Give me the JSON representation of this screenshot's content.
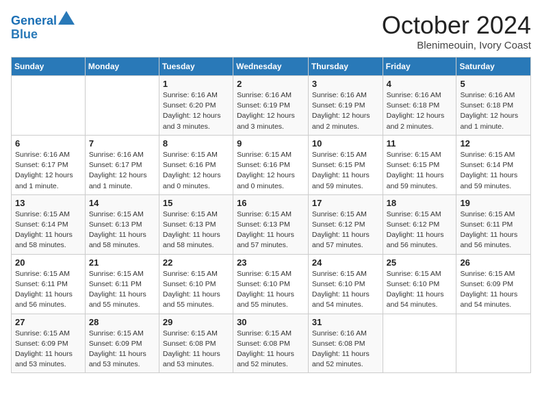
{
  "header": {
    "logo_line1": "General",
    "logo_line2": "Blue",
    "month_title": "October 2024",
    "location": "Blenimeouin, Ivory Coast"
  },
  "weekdays": [
    "Sunday",
    "Monday",
    "Tuesday",
    "Wednesday",
    "Thursday",
    "Friday",
    "Saturday"
  ],
  "weeks": [
    [
      {
        "day": "",
        "sunrise": "",
        "sunset": "",
        "daylight": ""
      },
      {
        "day": "",
        "sunrise": "",
        "sunset": "",
        "daylight": ""
      },
      {
        "day": "1",
        "sunrise": "Sunrise: 6:16 AM",
        "sunset": "Sunset: 6:20 PM",
        "daylight": "Daylight: 12 hours and 3 minutes."
      },
      {
        "day": "2",
        "sunrise": "Sunrise: 6:16 AM",
        "sunset": "Sunset: 6:19 PM",
        "daylight": "Daylight: 12 hours and 3 minutes."
      },
      {
        "day": "3",
        "sunrise": "Sunrise: 6:16 AM",
        "sunset": "Sunset: 6:19 PM",
        "daylight": "Daylight: 12 hours and 2 minutes."
      },
      {
        "day": "4",
        "sunrise": "Sunrise: 6:16 AM",
        "sunset": "Sunset: 6:18 PM",
        "daylight": "Daylight: 12 hours and 2 minutes."
      },
      {
        "day": "5",
        "sunrise": "Sunrise: 6:16 AM",
        "sunset": "Sunset: 6:18 PM",
        "daylight": "Daylight: 12 hours and 1 minute."
      }
    ],
    [
      {
        "day": "6",
        "sunrise": "Sunrise: 6:16 AM",
        "sunset": "Sunset: 6:17 PM",
        "daylight": "Daylight: 12 hours and 1 minute."
      },
      {
        "day": "7",
        "sunrise": "Sunrise: 6:16 AM",
        "sunset": "Sunset: 6:17 PM",
        "daylight": "Daylight: 12 hours and 1 minute."
      },
      {
        "day": "8",
        "sunrise": "Sunrise: 6:15 AM",
        "sunset": "Sunset: 6:16 PM",
        "daylight": "Daylight: 12 hours and 0 minutes."
      },
      {
        "day": "9",
        "sunrise": "Sunrise: 6:15 AM",
        "sunset": "Sunset: 6:16 PM",
        "daylight": "Daylight: 12 hours and 0 minutes."
      },
      {
        "day": "10",
        "sunrise": "Sunrise: 6:15 AM",
        "sunset": "Sunset: 6:15 PM",
        "daylight": "Daylight: 11 hours and 59 minutes."
      },
      {
        "day": "11",
        "sunrise": "Sunrise: 6:15 AM",
        "sunset": "Sunset: 6:15 PM",
        "daylight": "Daylight: 11 hours and 59 minutes."
      },
      {
        "day": "12",
        "sunrise": "Sunrise: 6:15 AM",
        "sunset": "Sunset: 6:14 PM",
        "daylight": "Daylight: 11 hours and 59 minutes."
      }
    ],
    [
      {
        "day": "13",
        "sunrise": "Sunrise: 6:15 AM",
        "sunset": "Sunset: 6:14 PM",
        "daylight": "Daylight: 11 hours and 58 minutes."
      },
      {
        "day": "14",
        "sunrise": "Sunrise: 6:15 AM",
        "sunset": "Sunset: 6:13 PM",
        "daylight": "Daylight: 11 hours and 58 minutes."
      },
      {
        "day": "15",
        "sunrise": "Sunrise: 6:15 AM",
        "sunset": "Sunset: 6:13 PM",
        "daylight": "Daylight: 11 hours and 58 minutes."
      },
      {
        "day": "16",
        "sunrise": "Sunrise: 6:15 AM",
        "sunset": "Sunset: 6:13 PM",
        "daylight": "Daylight: 11 hours and 57 minutes."
      },
      {
        "day": "17",
        "sunrise": "Sunrise: 6:15 AM",
        "sunset": "Sunset: 6:12 PM",
        "daylight": "Daylight: 11 hours and 57 minutes."
      },
      {
        "day": "18",
        "sunrise": "Sunrise: 6:15 AM",
        "sunset": "Sunset: 6:12 PM",
        "daylight": "Daylight: 11 hours and 56 minutes."
      },
      {
        "day": "19",
        "sunrise": "Sunrise: 6:15 AM",
        "sunset": "Sunset: 6:11 PM",
        "daylight": "Daylight: 11 hours and 56 minutes."
      }
    ],
    [
      {
        "day": "20",
        "sunrise": "Sunrise: 6:15 AM",
        "sunset": "Sunset: 6:11 PM",
        "daylight": "Daylight: 11 hours and 56 minutes."
      },
      {
        "day": "21",
        "sunrise": "Sunrise: 6:15 AM",
        "sunset": "Sunset: 6:11 PM",
        "daylight": "Daylight: 11 hours and 55 minutes."
      },
      {
        "day": "22",
        "sunrise": "Sunrise: 6:15 AM",
        "sunset": "Sunset: 6:10 PM",
        "daylight": "Daylight: 11 hours and 55 minutes."
      },
      {
        "day": "23",
        "sunrise": "Sunrise: 6:15 AM",
        "sunset": "Sunset: 6:10 PM",
        "daylight": "Daylight: 11 hours and 55 minutes."
      },
      {
        "day": "24",
        "sunrise": "Sunrise: 6:15 AM",
        "sunset": "Sunset: 6:10 PM",
        "daylight": "Daylight: 11 hours and 54 minutes."
      },
      {
        "day": "25",
        "sunrise": "Sunrise: 6:15 AM",
        "sunset": "Sunset: 6:10 PM",
        "daylight": "Daylight: 11 hours and 54 minutes."
      },
      {
        "day": "26",
        "sunrise": "Sunrise: 6:15 AM",
        "sunset": "Sunset: 6:09 PM",
        "daylight": "Daylight: 11 hours and 54 minutes."
      }
    ],
    [
      {
        "day": "27",
        "sunrise": "Sunrise: 6:15 AM",
        "sunset": "Sunset: 6:09 PM",
        "daylight": "Daylight: 11 hours and 53 minutes."
      },
      {
        "day": "28",
        "sunrise": "Sunrise: 6:15 AM",
        "sunset": "Sunset: 6:09 PM",
        "daylight": "Daylight: 11 hours and 53 minutes."
      },
      {
        "day": "29",
        "sunrise": "Sunrise: 6:15 AM",
        "sunset": "Sunset: 6:08 PM",
        "daylight": "Daylight: 11 hours and 53 minutes."
      },
      {
        "day": "30",
        "sunrise": "Sunrise: 6:15 AM",
        "sunset": "Sunset: 6:08 PM",
        "daylight": "Daylight: 11 hours and 52 minutes."
      },
      {
        "day": "31",
        "sunrise": "Sunrise: 6:16 AM",
        "sunset": "Sunset: 6:08 PM",
        "daylight": "Daylight: 11 hours and 52 minutes."
      },
      {
        "day": "",
        "sunrise": "",
        "sunset": "",
        "daylight": ""
      },
      {
        "day": "",
        "sunrise": "",
        "sunset": "",
        "daylight": ""
      }
    ]
  ]
}
